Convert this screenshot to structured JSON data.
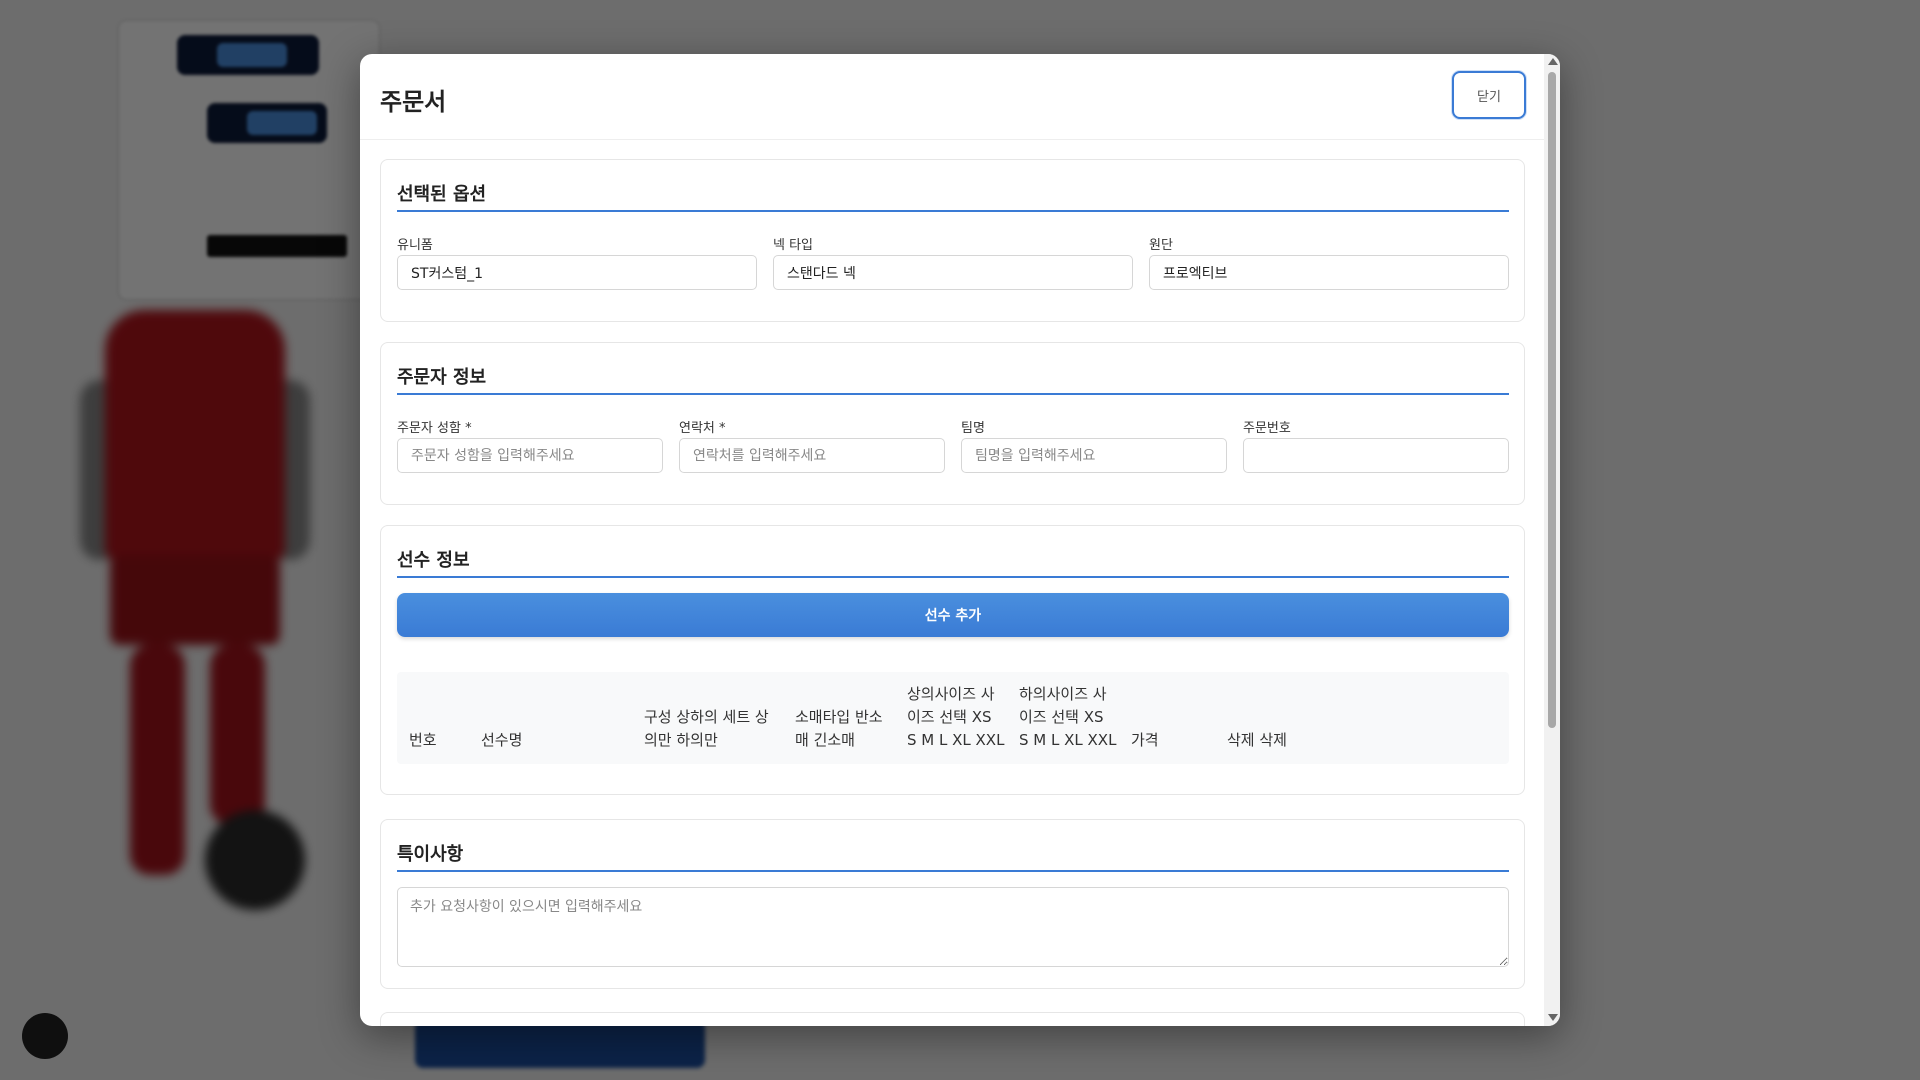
{
  "modal": {
    "title": "주문서",
    "close_label": "닫기"
  },
  "selected_options": {
    "title": "선택된 옵션",
    "fields": [
      {
        "label": "유니폼",
        "value": "ST커스텀_1"
      },
      {
        "label": "넥 타입",
        "value": "스탠다드 넥"
      },
      {
        "label": "원단",
        "value": "프로엑티브"
      }
    ]
  },
  "orderer_info": {
    "title": "주문자 정보",
    "fields": [
      {
        "label": "주문자 성함 *",
        "value": "",
        "placeholder": "주문자 성함을 입력해주세요"
      },
      {
        "label": "연락처 *",
        "value": "",
        "placeholder": "연락처를 입력해주세요"
      },
      {
        "label": "팀명",
        "value": "",
        "placeholder": "팀명을 입력해주세요"
      },
      {
        "label": "주문번호",
        "value": "",
        "placeholder": ""
      }
    ]
  },
  "player_info": {
    "title": "선수 정보",
    "add_button_label": "선수 추가",
    "columns": [
      {
        "lines": [
          "번호"
        ]
      },
      {
        "lines": [
          "선수명"
        ]
      },
      {
        "lines": [
          "구성 상하의 세트 상",
          "의만 하의만"
        ]
      },
      {
        "lines": [
          "소매타입 반소",
          "매 긴소매"
        ]
      },
      {
        "lines": [
          "상의사이즈 사",
          "이즈 선택 XS",
          "S M L XL XXL"
        ]
      },
      {
        "lines": [
          "하의사이즈 사",
          "이즈 선택 XS",
          "S M L XL XXL"
        ]
      },
      {
        "lines": [
          "가격"
        ]
      },
      {
        "lines": [
          "삭제 삭제"
        ]
      }
    ]
  },
  "notes": {
    "title": "특이사항",
    "placeholder": "추가 요청사항이 있으시면 입력해주세요"
  },
  "colors": {
    "accent": "#3a7bd5",
    "overlay": "rgba(0,0,0,0.55)"
  }
}
